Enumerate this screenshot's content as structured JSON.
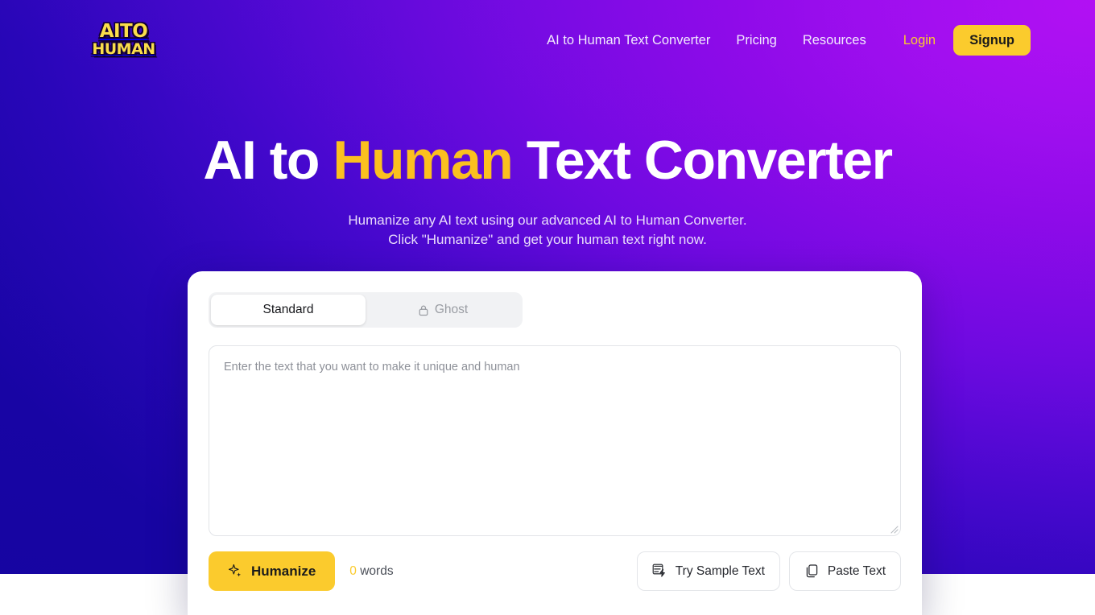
{
  "brand": {
    "logo_line1": "AITO",
    "logo_line2": "HUMAN",
    "logo_color": "#fade4b"
  },
  "header": {
    "nav": [
      {
        "label": "AI to Human Text Converter",
        "name": "nav-converter"
      },
      {
        "label": "Pricing",
        "name": "nav-pricing"
      },
      {
        "label": "Resources",
        "name": "nav-resources"
      }
    ],
    "login_label": "Login",
    "login_color": "#fbcb2d",
    "signup_label": "Signup",
    "signup_bg": "#fbcb2d"
  },
  "hero": {
    "title_part1": "AI to ",
    "title_accent": "Human",
    "title_part2": " Text Converter",
    "accent_color": "#fbc01f",
    "subtitle_line1": "Humanize any AI text using our advanced AI to Human Converter.",
    "subtitle_line2": "Click \"Humanize\" and get your human text right now."
  },
  "converter": {
    "tabs": [
      {
        "label": "Standard",
        "active": true,
        "icon": ""
      },
      {
        "label": "Ghost",
        "active": false,
        "icon": "lock-icon"
      }
    ],
    "editor": {
      "placeholder": "Enter the text that you want to make it unique and human",
      "value": ""
    },
    "humanize_label": "Humanize",
    "word_count_number": "0",
    "word_count_label": "words",
    "try_sample_label": "Try Sample Text",
    "paste_label": "Paste Text"
  },
  "theme": {
    "gradient_from": "#1a05a8",
    "gradient_to": "#b510f5",
    "card_bg": "#ffffff",
    "page_bg": "#ffffff"
  }
}
